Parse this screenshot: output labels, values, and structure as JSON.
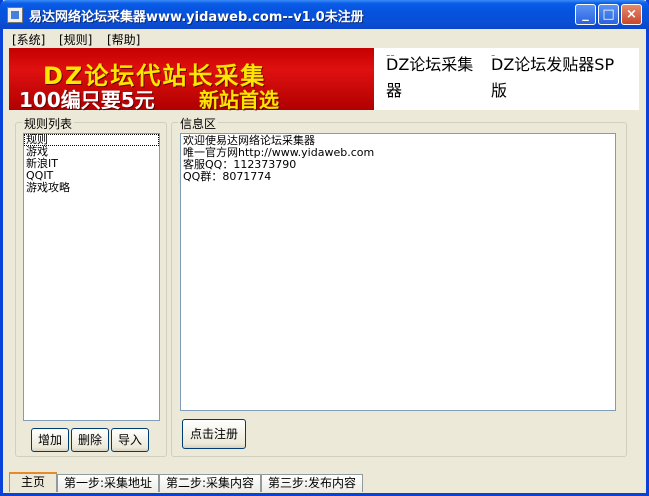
{
  "window": {
    "title": "易达网络论坛采集器www.yidaweb.com--v1.0未注册",
    "minimize_glyph": "_",
    "maximize_glyph": "□",
    "close_glyph": "×"
  },
  "menu": [
    "[系统]",
    "[规则]",
    "[帮助]"
  ],
  "banner": {
    "line1": "DZ论坛代站长采集",
    "line2": "100编只要5元",
    "line3": "新站首选",
    "link1_dash": "--",
    "link1": "DZ论坛采集器",
    "link2_dash": "-",
    "link2": "DZ论坛发贴器SP版"
  },
  "rules": {
    "title": "规则列表",
    "items": [
      "规则",
      "游戏",
      "新浪IT",
      "QQIT",
      "游戏攻略"
    ],
    "selected_index": 0,
    "add_label": "增加",
    "delete_label": "删除",
    "import_label": "导入"
  },
  "info": {
    "title": "信息区",
    "lines": [
      "欢迎使易达网络论坛采集器",
      "唯一官方网http://www.yidaweb.com",
      "客服QQ：112373790",
      "QQ群：8071774"
    ],
    "register_label": "点击注册"
  },
  "tabs": [
    "主页",
    "第一步:采集地址",
    "第二步:采集内容",
    "第三步:发布内容"
  ],
  "active_tab": 0
}
